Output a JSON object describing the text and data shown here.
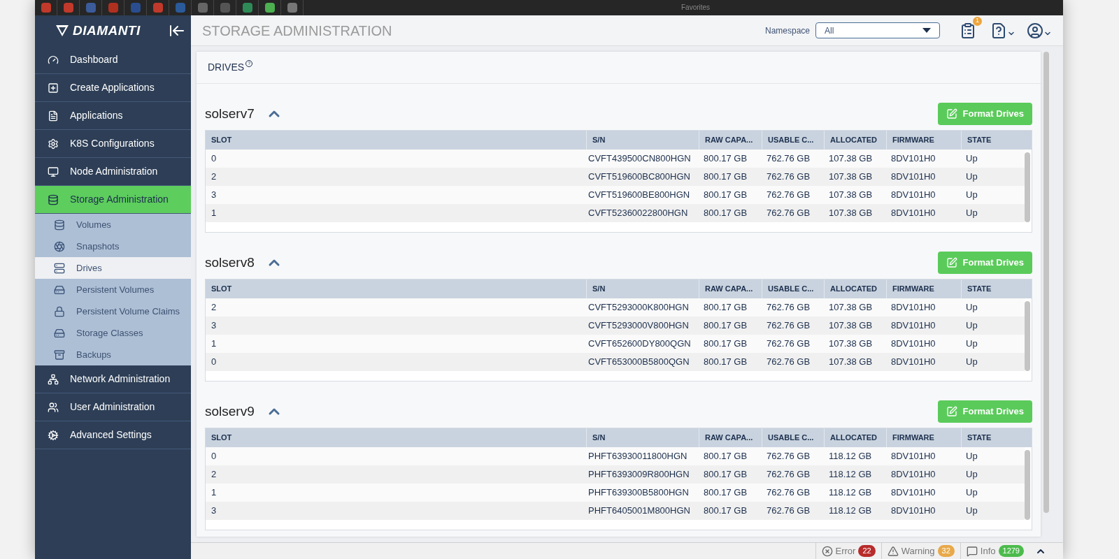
{
  "browser_bar": {
    "bookmarks_count_label": "Favorites"
  },
  "sidebar": {
    "logo": "DIAMANTI",
    "items": [
      {
        "label": "Dashboard",
        "selected": false
      },
      {
        "label": "Create Applications",
        "selected": false
      },
      {
        "label": "Applications",
        "selected": false
      },
      {
        "label": "K8S Configurations",
        "selected": false
      },
      {
        "label": "Node Administration",
        "selected": false
      },
      {
        "label": "Storage Administration",
        "selected": true,
        "expanded": true,
        "children": [
          {
            "label": "Volumes",
            "selected": false
          },
          {
            "label": "Snapshots",
            "selected": false
          },
          {
            "label": "Drives",
            "selected": true
          },
          {
            "label": "Persistent Volumes",
            "selected": false
          },
          {
            "label": "Persistent Volume Claims",
            "selected": false
          },
          {
            "label": "Storage Classes",
            "selected": false
          },
          {
            "label": "Backups",
            "selected": false
          }
        ]
      },
      {
        "label": "Network Administration",
        "selected": false
      },
      {
        "label": "User Administration",
        "selected": false
      },
      {
        "label": "Advanced Settings",
        "selected": false
      }
    ]
  },
  "header": {
    "title": "STORAGE ADMINISTRATION",
    "namespace_label": "Namespace",
    "namespace_value": "All",
    "tasks_badge": "1"
  },
  "panel": {
    "title": "DRIVES",
    "help_mark": "?"
  },
  "nodes": [
    {
      "name": "solserv7",
      "expanded": true,
      "button": "Format Drives",
      "columns": [
        "SLOT",
        "S/N",
        "RAW CAPA...",
        "USABLE C...",
        "ALLOCATED",
        "FIRMWARE",
        "STATE"
      ],
      "rows": [
        [
          "0",
          "CVFT439500CN800HGN",
          "800.17 GB",
          "762.76 GB",
          "107.38 GB",
          "8DV101H0",
          "Up"
        ],
        [
          "2",
          "CVFT519600BC800HGN",
          "800.17 GB",
          "762.76 GB",
          "107.38 GB",
          "8DV101H0",
          "Up"
        ],
        [
          "3",
          "CVFT519600BE800HGN",
          "800.17 GB",
          "762.76 GB",
          "107.38 GB",
          "8DV101H0",
          "Up"
        ],
        [
          "1",
          "CVFT52360022800HGN",
          "800.17 GB",
          "762.76 GB",
          "107.38 GB",
          "8DV101H0",
          "Up"
        ]
      ]
    },
    {
      "name": "solserv8",
      "expanded": true,
      "button": "Format Drives",
      "columns": [
        "SLOT",
        "S/N",
        "RAW CAPA...",
        "USABLE C...",
        "ALLOCATED",
        "FIRMWARE",
        "STATE"
      ],
      "rows": [
        [
          "2",
          "CVFT5293000K800HGN",
          "800.17 GB",
          "762.76 GB",
          "107.38 GB",
          "8DV101H0",
          "Up"
        ],
        [
          "3",
          "CVFT5293000V800HGN",
          "800.17 GB",
          "762.76 GB",
          "107.38 GB",
          "8DV101H0",
          "Up"
        ],
        [
          "1",
          "CVFT652600DY800QGN",
          "800.17 GB",
          "762.76 GB",
          "107.38 GB",
          "8DV101H0",
          "Up"
        ],
        [
          "0",
          "CVFT653000B5800QGN",
          "800.17 GB",
          "762.76 GB",
          "107.38 GB",
          "8DV101H0",
          "Up"
        ]
      ]
    },
    {
      "name": "solserv9",
      "expanded": true,
      "button": "Format Drives",
      "columns": [
        "SLOT",
        "S/N",
        "RAW CAPA...",
        "USABLE C...",
        "ALLOCATED",
        "FIRMWARE",
        "STATE"
      ],
      "rows": [
        [
          "0",
          "PHFT63930011800HGN",
          "800.17 GB",
          "762.76 GB",
          "118.12 GB",
          "8DV101H0",
          "Up"
        ],
        [
          "2",
          "PHFT6393009R800HGN",
          "800.17 GB",
          "762.76 GB",
          "118.12 GB",
          "8DV101H0",
          "Up"
        ],
        [
          "1",
          "PHFT639300B5800HGN",
          "800.17 GB",
          "762.76 GB",
          "118.12 GB",
          "8DV101H0",
          "Up"
        ],
        [
          "3",
          "PHFT6405001M800HGN",
          "800.17 GB",
          "762.76 GB",
          "118.12 GB",
          "8DV101H0",
          "Up"
        ]
      ]
    }
  ],
  "status_bar": [
    {
      "kind": "error",
      "label": "Error",
      "count": "22"
    },
    {
      "kind": "warning",
      "label": "Warning",
      "count": "32"
    },
    {
      "kind": "info",
      "label": "Info",
      "count": "1279"
    }
  ]
}
